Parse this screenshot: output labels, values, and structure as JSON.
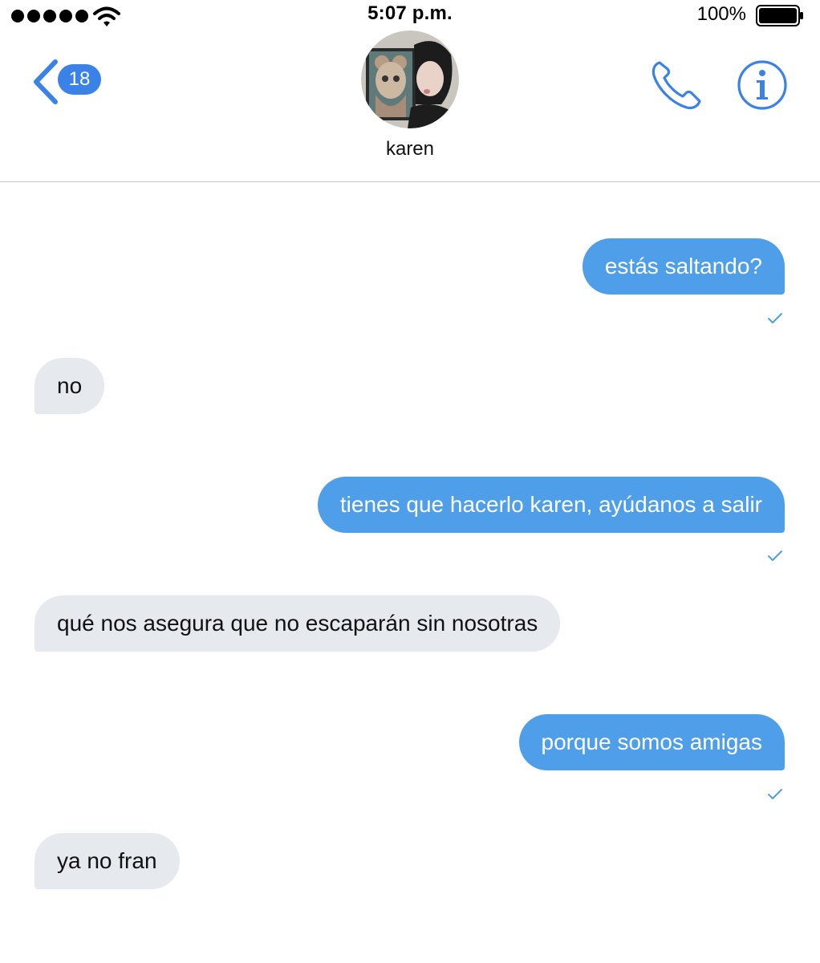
{
  "status_bar": {
    "time": "5:07 p.m.",
    "battery_percent": "100%",
    "signal_bars": 5,
    "icons": [
      "signal-dots-icon",
      "wifi-icon",
      "battery-icon"
    ]
  },
  "header": {
    "back_badge_count": "18",
    "contact_name": "karen",
    "icons": [
      "chevron-left-icon",
      "phone-icon",
      "info-icon"
    ],
    "accent_color": "#3b82e8"
  },
  "messages": [
    {
      "direction": "sent",
      "text": "estás saltando?",
      "status": "read-check-icon"
    },
    {
      "direction": "received",
      "text": "no"
    },
    {
      "direction": "sent",
      "text": "tienes que hacerlo karen, ayúdanos a salir",
      "status": "read-check-icon"
    },
    {
      "direction": "received",
      "text": "qué nos asegura que no escaparán sin nosotras"
    },
    {
      "direction": "sent",
      "text": "porque somos amigas",
      "status": "read-check-icon"
    },
    {
      "direction": "received",
      "text": "ya no fran"
    }
  ],
  "colors": {
    "sent_bubble": "#4f9ee9",
    "received_bubble": "#e6e9ee",
    "divider": "#c8c8cc"
  }
}
